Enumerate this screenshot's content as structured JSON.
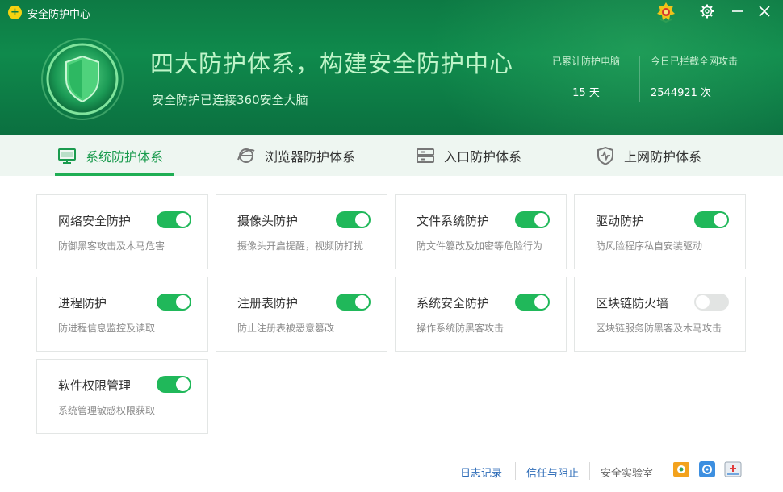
{
  "window": {
    "title": "安全防护中心"
  },
  "header": {
    "headline": "四大防护体系，构建安全防护中心",
    "subline": "安全防护已连接360安全大脑",
    "stats": [
      {
        "label": "已累计防护电脑",
        "value": "15 天"
      },
      {
        "label": "今日已拦截全网攻击",
        "value": "2544921 次"
      }
    ]
  },
  "tabs": [
    {
      "label": "系统防护体系",
      "icon": "monitor-icon",
      "active": true
    },
    {
      "label": "浏览器防护体系",
      "icon": "browser-icon",
      "active": false
    },
    {
      "label": "入口防护体系",
      "icon": "server-icon",
      "active": false
    },
    {
      "label": "上网防护体系",
      "icon": "pulse-shield-icon",
      "active": false
    }
  ],
  "cards": [
    {
      "title": "网络安全防护",
      "desc": "防御黑客攻击及木马危害",
      "enabled": true
    },
    {
      "title": "摄像头防护",
      "desc": "摄像头开启提醒，视频防打扰",
      "enabled": true
    },
    {
      "title": "文件系统防护",
      "desc": "防文件篡改及加密等危险行为",
      "enabled": true
    },
    {
      "title": "驱动防护",
      "desc": "防风险程序私自安装驱动",
      "enabled": true
    },
    {
      "title": "进程防护",
      "desc": "防进程信息监控及读取",
      "enabled": true
    },
    {
      "title": "注册表防护",
      "desc": "防止注册表被恶意篡改",
      "enabled": true
    },
    {
      "title": "系统安全防护",
      "desc": "操作系统防黑客攻击",
      "enabled": true
    },
    {
      "title": "区块链防火墙",
      "desc": "区块链服务防黑客及木马攻击",
      "enabled": false
    },
    {
      "title": "软件权限管理",
      "desc": "系统管理敏感权限获取",
      "enabled": true
    }
  ],
  "footer": {
    "links": [
      "日志记录",
      "信任与阻止"
    ],
    "lab": "安全实验室",
    "icons": [
      "lab-app-icon-1",
      "lab-app-icon-2",
      "lab-app-icon-3"
    ]
  },
  "colors": {
    "header_green": "#0f8a4c",
    "accent_green": "#1fae54",
    "toggle_off": "#e2e4e3",
    "link_blue": "#2f6db8"
  }
}
